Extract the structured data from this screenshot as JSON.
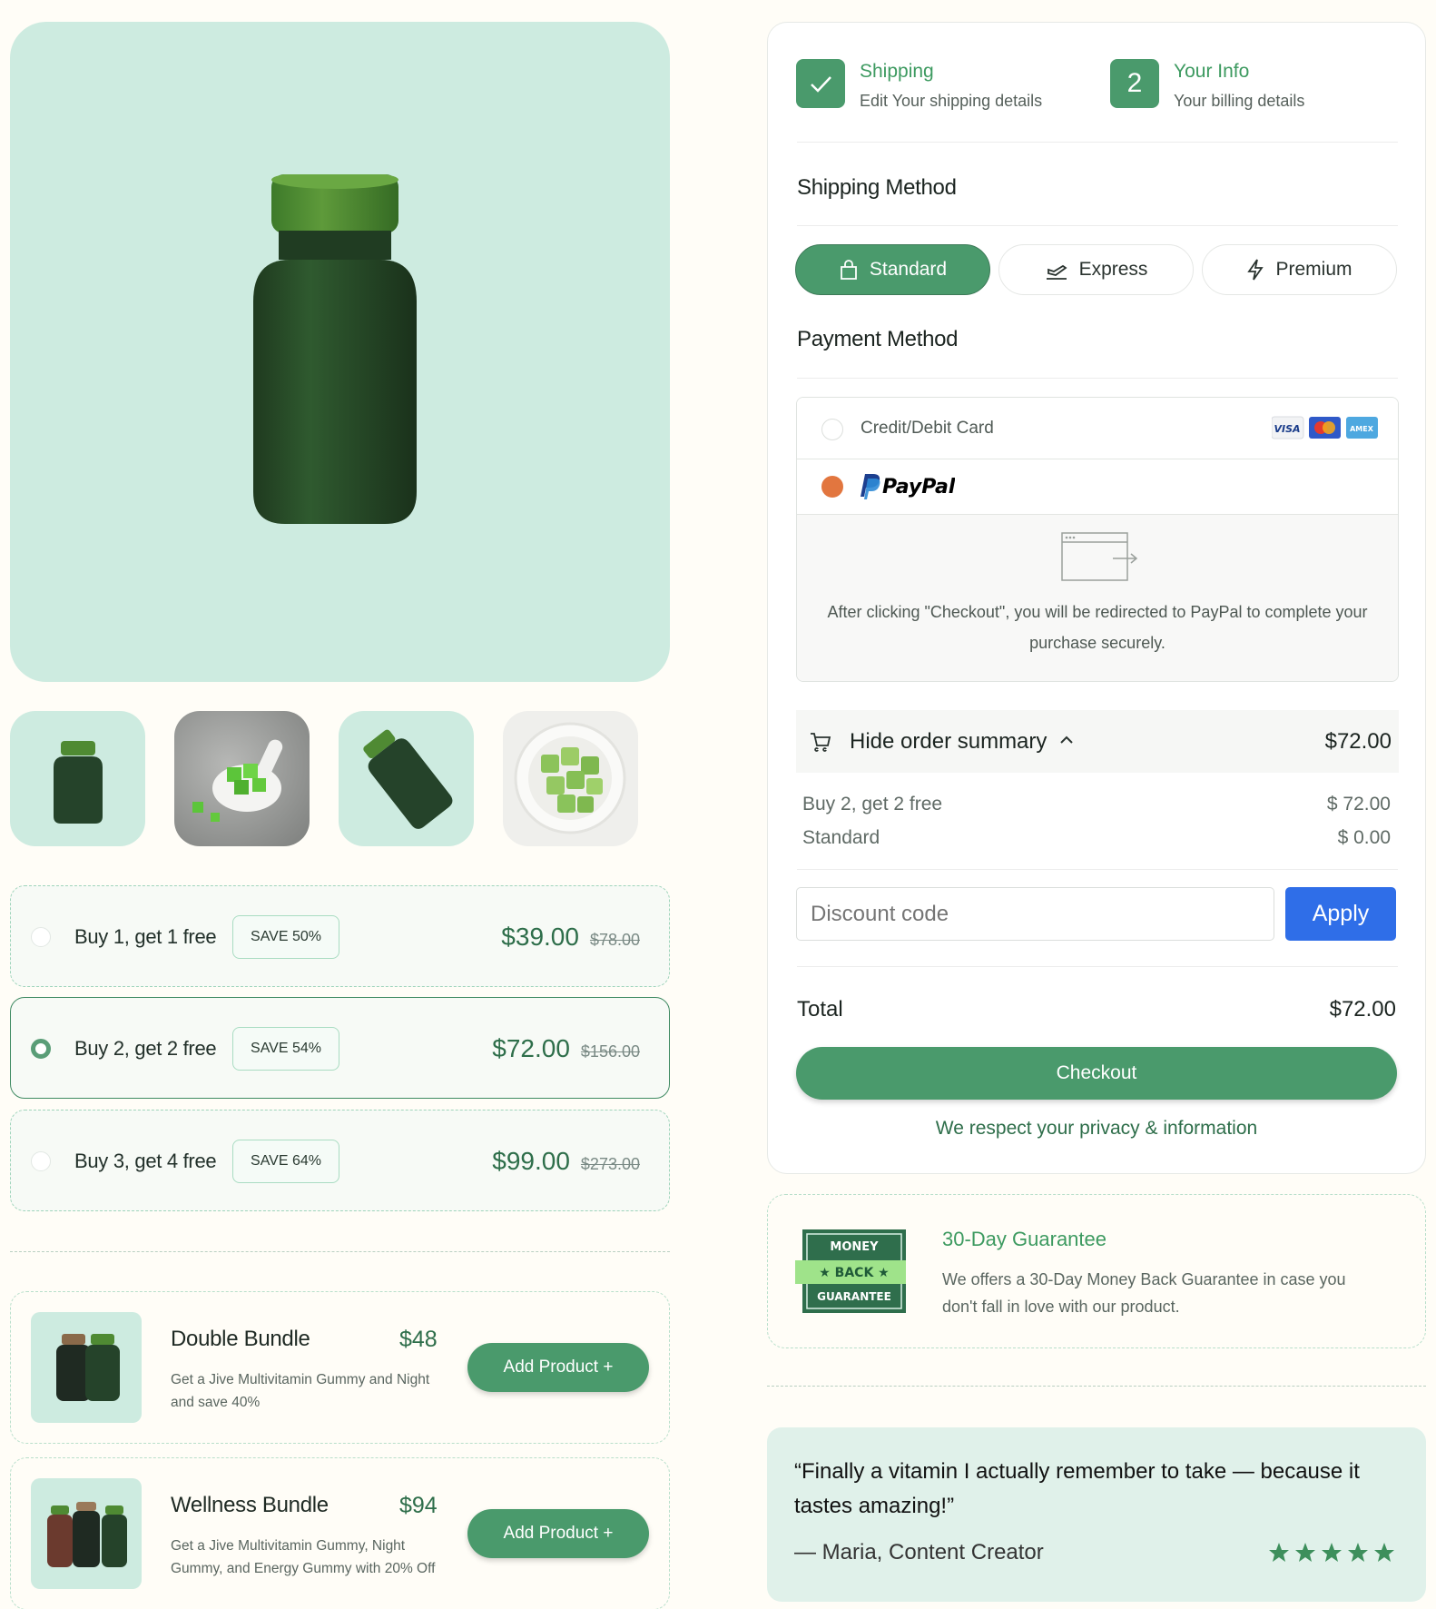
{
  "thumbnails": [
    {
      "icon": "bottle-thumb-icon"
    },
    {
      "icon": "gummies-spoon-thumb-icon"
    },
    {
      "icon": "bottle-tilted-thumb-icon"
    },
    {
      "icon": "gummies-plate-thumb-icon"
    }
  ],
  "offers": [
    {
      "label": "Buy 1, get 1 free",
      "save": "SAVE 50%",
      "price": "$39.00",
      "was": "$78.00",
      "selected": false
    },
    {
      "label": "Buy 2, get 2 free",
      "save": "SAVE 54%",
      "price": "$72.00",
      "was": "$156.00",
      "selected": true
    },
    {
      "label": "Buy 3, get 4 free",
      "save": "SAVE 64%",
      "price": "$99.00",
      "was": "$273.00",
      "selected": false
    }
  ],
  "bundles": [
    {
      "name": "Double Bundle",
      "price": "$48",
      "desc": "Get a Jive Multivitamin Gummy and Night and save 40%",
      "button": "Add Product +"
    },
    {
      "name": "Wellness Bundle",
      "price": "$94",
      "desc": "Get a Jive Multivitamin Gummy, Night Gummy, and Energy Gummy with 20% Off",
      "button": "Add Product +"
    }
  ],
  "steps": [
    {
      "title": "Shipping",
      "subtitle": "Edit Your shipping details",
      "indicator": "check-icon"
    },
    {
      "title": "Your Info",
      "subtitle": "Your billing details",
      "indicator": "2"
    }
  ],
  "shipping": {
    "title": "Shipping Method",
    "options": [
      {
        "label": "Standard",
        "icon": "shopping-bag-icon",
        "active": true
      },
      {
        "label": "Express",
        "icon": "plane-departure-icon",
        "active": false
      },
      {
        "label": "Premium",
        "icon": "lightning-icon",
        "active": false
      }
    ]
  },
  "payment": {
    "title": "Payment Method",
    "card_label": "Credit/Debit Card",
    "card_brands": [
      "VISA",
      "Mastercard",
      "AMEX"
    ],
    "paypal_label": "PayPal",
    "selected": "paypal",
    "redirect_note": "After clicking \"Checkout\", you will be redirected to PayPal to complete your purchase securely."
  },
  "summary": {
    "toggle_label": "Hide order summary",
    "total_header": "$72.00",
    "lines": [
      {
        "label": "Buy 2, get 2 free",
        "value": "$ 72.00"
      },
      {
        "label": "Standard",
        "value": "$ 0.00"
      }
    ],
    "discount_placeholder": "Discount code",
    "apply_label": "Apply",
    "total_label": "Total",
    "total_value": "$72.00",
    "checkout_label": "Checkout",
    "privacy_note": "We respect your privacy & information"
  },
  "guarantee": {
    "badge_top": "MONEY",
    "badge_mid": "★ BACK ★",
    "badge_bottom": "GUARANTEE",
    "title": "30-Day Guarantee",
    "text": "We offers a 30-Day Money Back Guarantee in case you don't fall in love with our product."
  },
  "testimonial": {
    "quote": "“Finally a vitamin I actually remember to take — because it tastes amazing!”",
    "author": "— Maria, Content Creator",
    "rating": 5
  },
  "colors": {
    "brand_green": "#4a9a6c",
    "mint_bg": "#cdebe0",
    "apply_blue": "#2f6ee8",
    "paypal_orange": "#e2763f",
    "page_bg": "#fffdf7"
  }
}
